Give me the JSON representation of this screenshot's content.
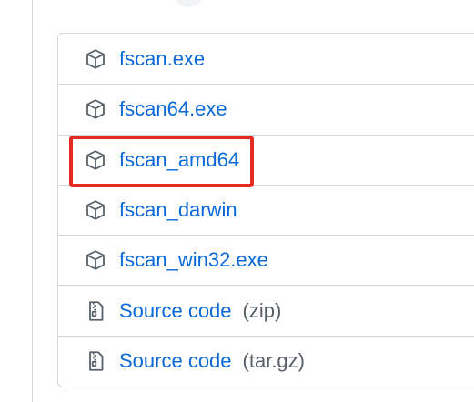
{
  "assets": [
    {
      "name": "fscan.exe",
      "icon": "package-icon",
      "suffix": ""
    },
    {
      "name": "fscan64.exe",
      "icon": "package-icon",
      "suffix": ""
    },
    {
      "name": "fscan_amd64",
      "icon": "package-icon",
      "suffix": ""
    },
    {
      "name": "fscan_darwin",
      "icon": "package-icon",
      "suffix": ""
    },
    {
      "name": "fscan_win32.exe",
      "icon": "package-icon",
      "suffix": ""
    },
    {
      "name": "Source code",
      "icon": "file-zip-icon",
      "suffix": "(zip)"
    },
    {
      "name": "Source code",
      "icon": "file-zip-icon",
      "suffix": "(tar.gz)"
    }
  ],
  "colors": {
    "link": "#0969da",
    "muted": "#57606a",
    "border": "#d0d7de",
    "highlight": "#e52a24"
  }
}
